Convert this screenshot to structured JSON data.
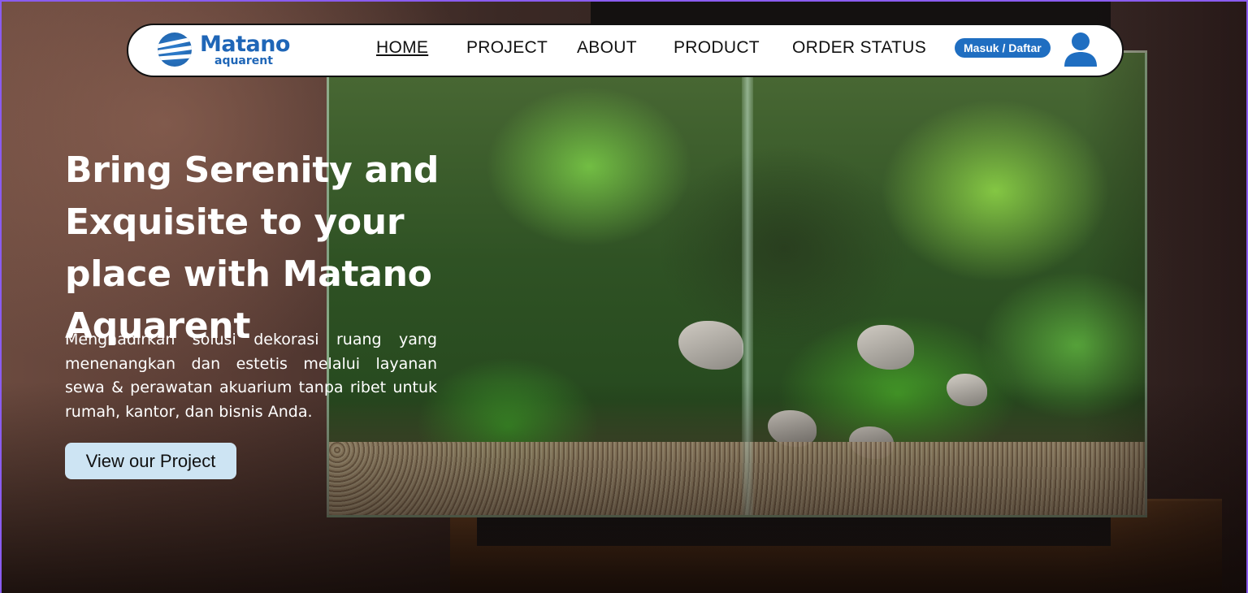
{
  "brand": {
    "title": "Matano",
    "subtitle": "aquarent",
    "color": "#1f66b7"
  },
  "nav": {
    "items": [
      {
        "label": "HOME",
        "active": true
      },
      {
        "label": "PROJECT",
        "active": false
      },
      {
        "label": "ABOUT",
        "active": false
      },
      {
        "label": "PRODUCT",
        "active": false
      },
      {
        "label": "ORDER STATUS",
        "active": false
      }
    ],
    "login_label": "Masuk / Daftar",
    "user_icon": "user-icon",
    "accent": "#1f6ec1"
  },
  "hero": {
    "title": "Bring Serenity and Exquisite to your place with Matano Aquarent",
    "description": "Menghadirkan solusi dekorasi ruang yang menenangkan dan estetis melalui layanan sewa & perawatan akuarium tanpa ribet untuk rumah, kantor, dan bisnis Anda.",
    "cta_label": "View our Project",
    "cta_color": "#cde4f3"
  }
}
